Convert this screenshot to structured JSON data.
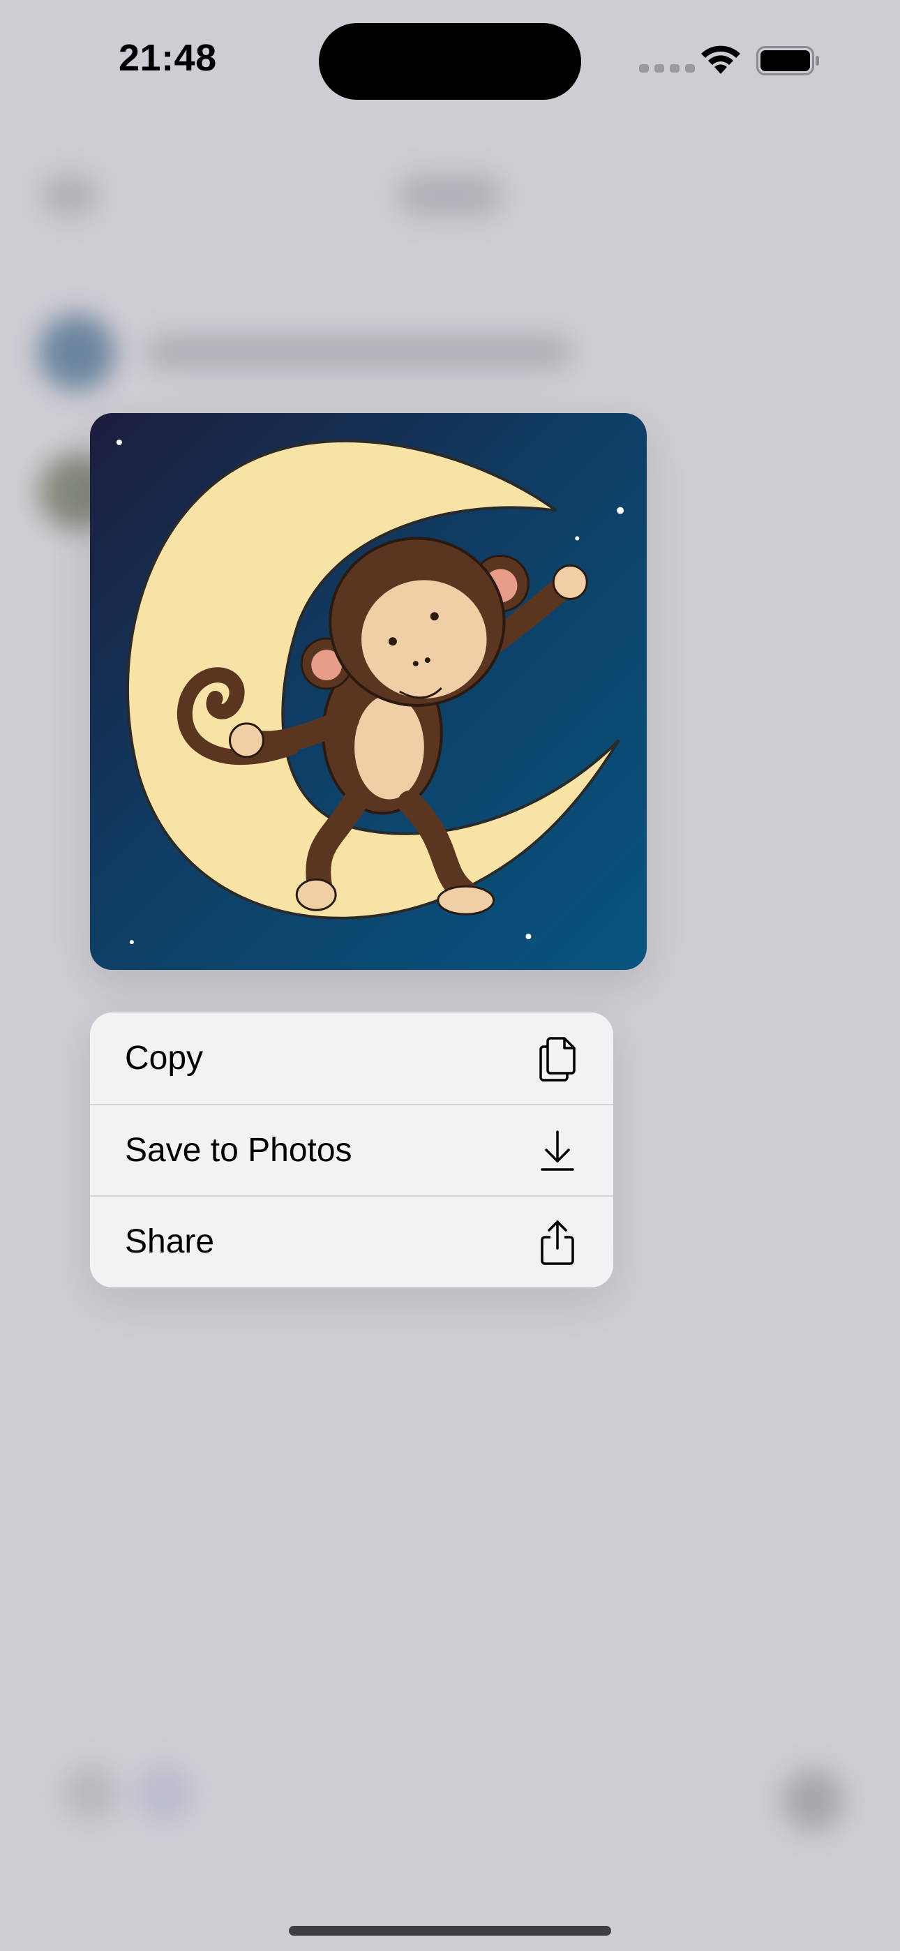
{
  "status_bar": {
    "time": "21:48",
    "icons": [
      "cellular-dots-icon",
      "wifi-icon",
      "battery-icon"
    ]
  },
  "preview": {
    "image": "cartoon monkey dancing on a crescent moon in a starry night sky",
    "colors": {
      "sky_top": "#1b1f3c",
      "sky_bottom": "#0b4f78",
      "moon": "#f7e3a5",
      "monkey": "#5a3621",
      "skin": "#f0cfa6"
    }
  },
  "menu": {
    "items": [
      {
        "label": "Copy",
        "icon": "copy-documents-icon"
      },
      {
        "label": "Save to Photos",
        "icon": "download-icon"
      },
      {
        "label": "Share",
        "icon": "share-icon"
      }
    ]
  }
}
